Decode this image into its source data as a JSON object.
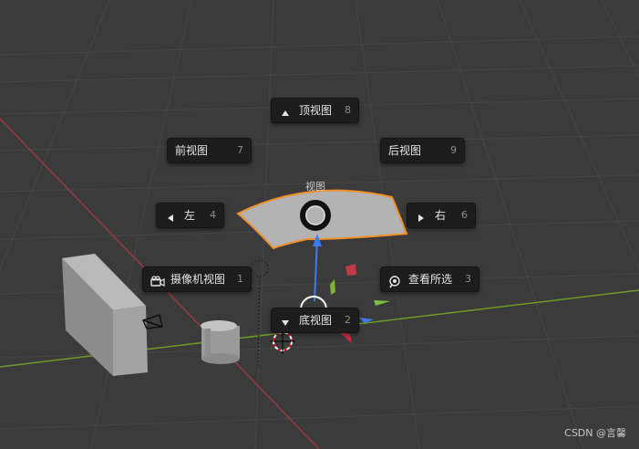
{
  "pie_menu": {
    "title": "视图",
    "top": {
      "label": "顶视图",
      "key": "8",
      "icon": "triangle-up-icon"
    },
    "front": {
      "label": "前视图",
      "key": "7"
    },
    "back": {
      "label": "后视图",
      "key": "9"
    },
    "left": {
      "label": "左",
      "key": "4",
      "icon": "triangle-left-icon"
    },
    "right": {
      "label": "右",
      "key": "6",
      "icon": "triangle-right-icon"
    },
    "camera": {
      "label": "摄像机视图",
      "key": "1",
      "icon": "camera-icon"
    },
    "selected": {
      "label": "查看所选",
      "key": "3",
      "icon": "zoom-selected-icon"
    },
    "bottom": {
      "label": "底视图",
      "key": "2",
      "icon": "triangle-down-icon"
    }
  },
  "watermark": "CSDN @言馨",
  "colors": {
    "background": "#3b3b3b",
    "grid": "#4a4a4a",
    "x_axis": "#9a3a44",
    "y_axis": "#6e9a2c",
    "selection_outline": "#f0902c",
    "gizmo_blue": "#3d7cf0"
  }
}
